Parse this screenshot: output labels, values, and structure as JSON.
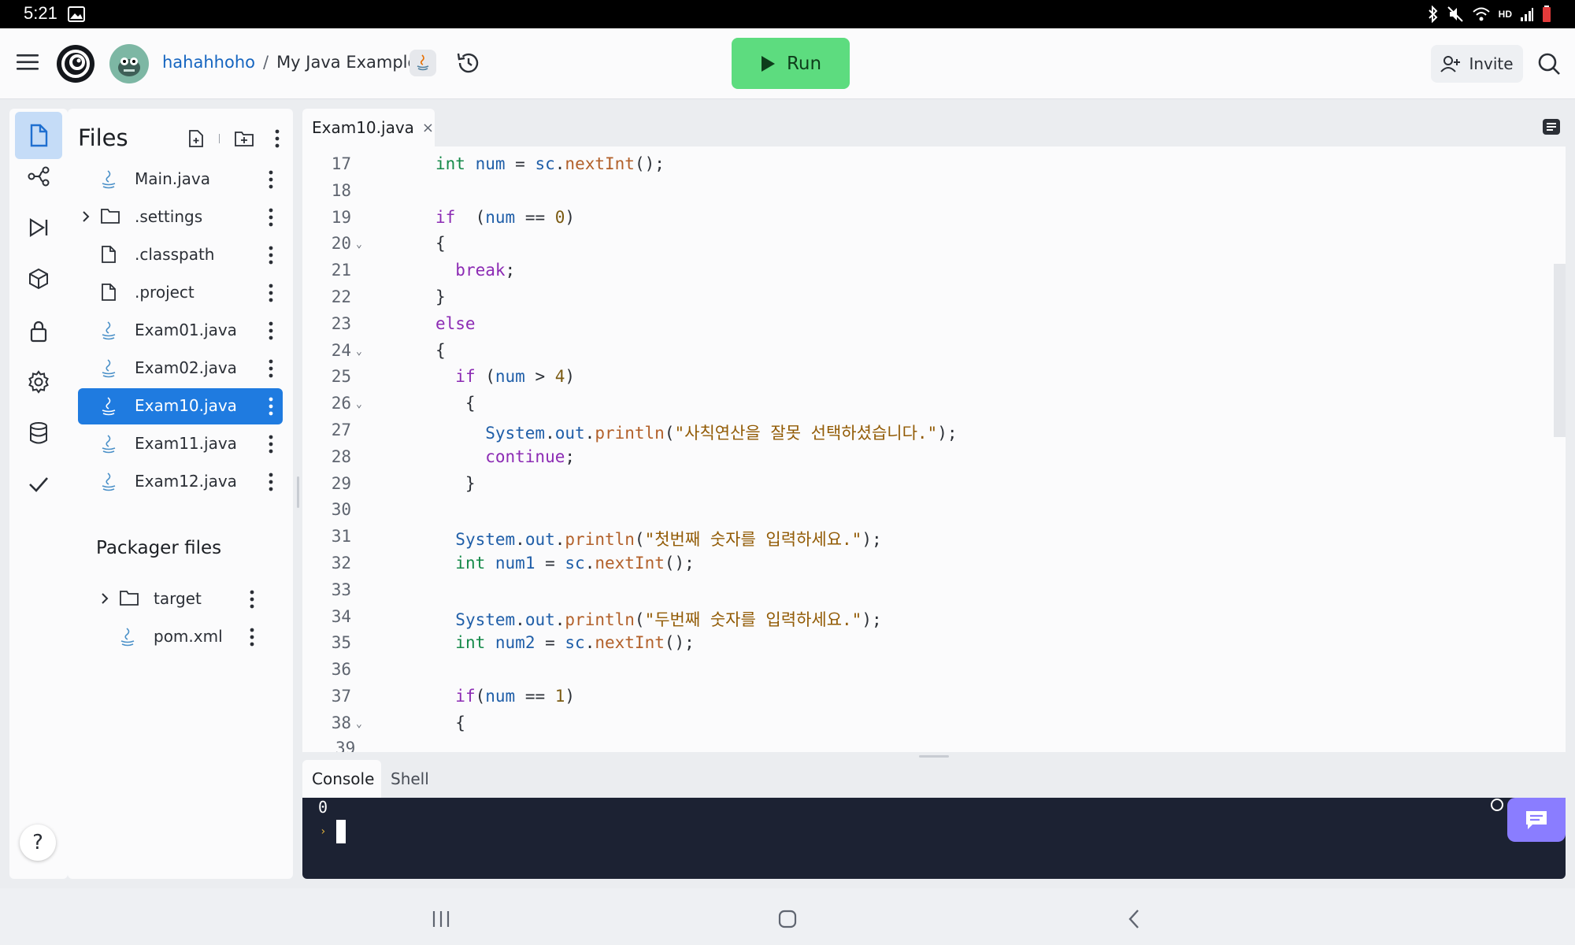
{
  "status_bar": {
    "time": "5:21",
    "icons": [
      "gallery-icon",
      "bluetooth-icon",
      "mute-icon",
      "wifi-icon",
      "hd-voice-icon",
      "signal-icon",
      "battery-icon"
    ],
    "hd_label": "HD"
  },
  "header": {
    "user": "hahahhoho",
    "separator": "/",
    "project": "My Java Example",
    "run_label": "Run",
    "invite_label": "Invite",
    "run_color": "#5ddc7f"
  },
  "sidebar": {
    "items": [
      "files-icon",
      "git-icon",
      "debugger-icon",
      "packages-icon",
      "secrets-icon",
      "settings-icon",
      "database-icon",
      "check-icon"
    ],
    "help_label": "?"
  },
  "files_panel": {
    "title": "Files",
    "files": [
      {
        "name": "Main.java",
        "icon": "java-icon"
      },
      {
        "name": ".settings",
        "icon": "folder-icon"
      },
      {
        "name": ".classpath",
        "icon": "file-icon"
      },
      {
        "name": ".project",
        "icon": "file-icon"
      },
      {
        "name": "Exam01.java",
        "icon": "java-icon"
      },
      {
        "name": "Exam02.java",
        "icon": "java-icon"
      },
      {
        "name": "Exam10.java",
        "icon": "java-icon",
        "selected": true
      },
      {
        "name": "Exam11.java",
        "icon": "java-icon"
      },
      {
        "name": "Exam12.java",
        "icon": "java-icon"
      }
    ],
    "packager_title": "Packager files",
    "packager_files": [
      {
        "name": "target",
        "icon": "folder-icon"
      },
      {
        "name": "pom.xml",
        "icon": "java-icon"
      }
    ]
  },
  "editor": {
    "tab_label": "Exam10.java",
    "tab_close": "×",
    "lines": [
      {
        "n": "17",
        "text": "int num = sc.nextInt();"
      },
      {
        "n": "18",
        "text": ""
      },
      {
        "n": "19",
        "text": "if  (num == 0)"
      },
      {
        "n": "20",
        "text": "{",
        "fold": true
      },
      {
        "n": "21",
        "text": "  break;"
      },
      {
        "n": "22",
        "text": "}"
      },
      {
        "n": "23",
        "text": "else"
      },
      {
        "n": "24",
        "text": "{",
        "fold": true
      },
      {
        "n": "25",
        "text": "  if (num > 4)"
      },
      {
        "n": "26",
        "text": "   {",
        "fold": true
      },
      {
        "n": "27",
        "text": "     System.out.println(\"사칙연산을 잘못 선택하셨습니다.\");"
      },
      {
        "n": "28",
        "text": "     continue;"
      },
      {
        "n": "29",
        "text": "   }"
      },
      {
        "n": "30",
        "text": ""
      },
      {
        "n": "31",
        "text": "  System.out.println(\"첫번째 숫자를 입력하세요.\");"
      },
      {
        "n": "32",
        "text": "  int num1 = sc.nextInt();"
      },
      {
        "n": "33",
        "text": ""
      },
      {
        "n": "34",
        "text": "  System.out.println(\"두번째 숫자를 입력하세요.\");"
      },
      {
        "n": "35",
        "text": "  int num2 = sc.nextInt();"
      },
      {
        "n": "36",
        "text": ""
      },
      {
        "n": "37",
        "text": "  if(num == 1)"
      },
      {
        "n": "38",
        "text": "  {",
        "fold": true
      }
    ]
  },
  "console": {
    "tabs": [
      "Console",
      "Shell"
    ],
    "output": "0"
  }
}
